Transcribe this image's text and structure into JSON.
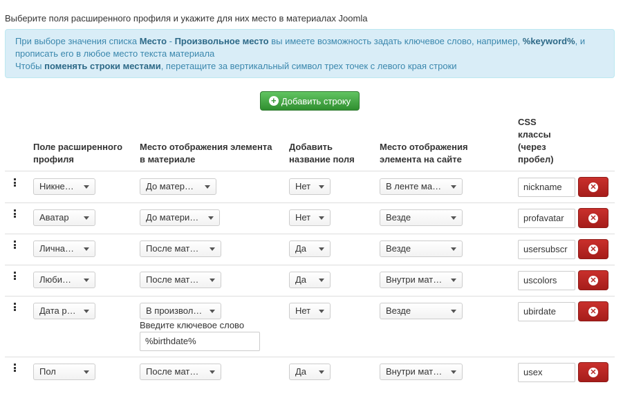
{
  "intro": "Выберите поля расширенного профиля и укажите для них место в материалах Joomla",
  "alert": {
    "l1_a": "При выборе значения списка ",
    "l1_b": "Место",
    "l1_c": " - ",
    "l1_d": "Произвольное место",
    "l1_e": " вы имеете возможность задать ключевое слово, например, ",
    "l1_f": "%keyword%",
    "l1_g": ", и",
    "l2": "прописать его в любое место текста материала",
    "l3_a": "Чтобы ",
    "l3_b": "поменять строки местами",
    "l3_c": ", перетащите за вертикальный символ трех точек с левого края строки"
  },
  "add_button": "Добавить строку",
  "headers": {
    "field_1": "Поле расширенного",
    "field_2": "профиля",
    "place_1": "Место отображения элемента",
    "place_2": "в материале",
    "add_name_1": "Добавить",
    "add_name_2": "название поля",
    "site_1": "Место отображения",
    "site_2": "элемента на сайте",
    "css_1": "CSS",
    "css_2": "классы",
    "css_3": "(через",
    "css_4": "пробел)"
  },
  "rows": [
    {
      "field": "Никне…",
      "place": "До матер…",
      "add_name": "Нет",
      "site": "В ленте ма…",
      "css": "nickname"
    },
    {
      "field": "Аватар",
      "place": "До матери…",
      "add_name": "Нет",
      "site": "Везде",
      "css": "profavatar"
    },
    {
      "field": "Лична…",
      "place": "После мат…",
      "add_name": "Да",
      "site": "Везде",
      "css": "usersubscr"
    },
    {
      "field": "Люби…",
      "place": "После мат…",
      "add_name": "Да",
      "site": "Внутри мат…",
      "css": "uscolors"
    },
    {
      "field": "Дата р…",
      "place": "В произвол…",
      "add_name": "Нет",
      "site": "Везде",
      "css": "ubirdate"
    },
    {
      "field": "Пол",
      "place": "После мат…",
      "add_name": "Да",
      "site": "Внутри мат…",
      "css": "usex"
    }
  ],
  "keyword": {
    "label": "Введите ключевое слово",
    "value": "%birthdate%"
  },
  "colors": {
    "alert_bg": "#d9edf7",
    "alert_text": "#3a87ad",
    "add_button": "#449d44",
    "delete_button": "#bd362f"
  }
}
